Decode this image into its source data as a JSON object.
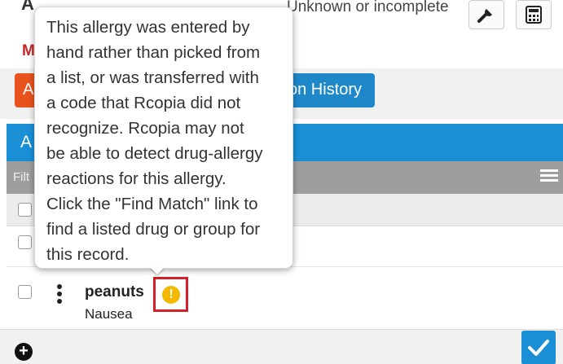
{
  "top": {
    "status_text": "Unknown or incomplete",
    "partial_heading": "A",
    "partial_label": "M"
  },
  "buttons": {
    "left_label": "A",
    "history_label": "on History"
  },
  "panel": {
    "header_partial": "A",
    "filter_partial": "Filt"
  },
  "allergies": [
    {
      "name": "peanuts",
      "reaction": "Nausea"
    }
  ],
  "tooltip": {
    "lines": [
      "This allergy was entered by",
      "hand rather than picked from",
      "a list, or was transferred with",
      "a code that Rcopia did not",
      "recognize. Rcopia may not",
      "be able to detect drug-allergy",
      "reactions for this allergy.",
      "Click the \"Find Match\" link to",
      "find a listed drug or group for",
      "this record."
    ]
  },
  "icons": {
    "wrench": "wrench-icon",
    "calculator": "calculator-icon",
    "list": "list-icon",
    "kebab": "kebab-menu-icon",
    "warning": "warning-icon",
    "add": "add-circle-icon",
    "check": "check-icon"
  },
  "colors": {
    "accent_blue": "#1a8fd6",
    "orange": "#e8531e",
    "warning_yellow": "#f5b800",
    "highlight_red": "#d32027"
  }
}
